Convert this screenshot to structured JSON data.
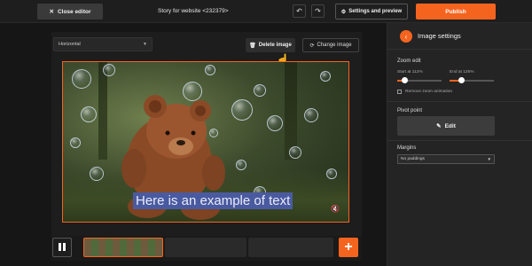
{
  "topbar": {
    "close_label": "Close editor",
    "title": "Story for website <232379>",
    "settings_label": "Settings and preview",
    "publish_label": "Publish"
  },
  "toolbar": {
    "orientation_value": "Horizontal",
    "delete_label": "Delete image",
    "change_label": "Change image"
  },
  "canvas": {
    "caption": "Here is an example of text"
  },
  "panel": {
    "title": "Image settings",
    "zoom": {
      "heading": "Zoom edit",
      "start_label": "Start at 112%",
      "end_label": "End at 125%",
      "start_value": 112,
      "end_value": 125,
      "remove_label": "Remove zoom animation"
    },
    "pivot": {
      "heading": "Pivot point",
      "edit_label": "Edit"
    },
    "margins": {
      "heading": "Margins",
      "value": "No paddings"
    }
  },
  "colors": {
    "accent": "#f5641f",
    "caption_bg": "#4a5aa0"
  },
  "icons": [
    "close-icon",
    "undo-icon",
    "redo-icon",
    "gear-icon",
    "trash-icon",
    "refresh-icon",
    "chevron-down-icon",
    "mute-icon",
    "pause-icon",
    "plus-icon",
    "back-arrow-icon",
    "pencil-icon"
  ]
}
